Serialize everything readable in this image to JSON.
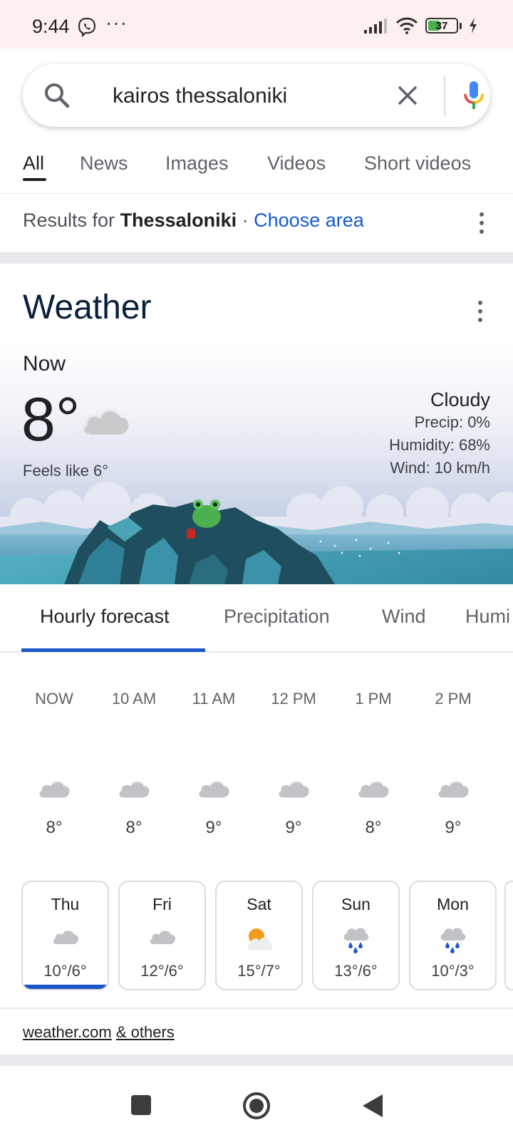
{
  "status": {
    "time": "9:44",
    "dots": "···",
    "battery": "37"
  },
  "search": {
    "query": "kairos thessaloniki"
  },
  "tabs": [
    "All",
    "News",
    "Images",
    "Videos",
    "Short videos"
  ],
  "results": {
    "prefix": "Results for",
    "place": "Thessaloniki",
    "separator": "·",
    "choose": "Choose area"
  },
  "weather": {
    "title": "Weather",
    "now_label": "Now",
    "temp": "8°",
    "feels": "Feels like 6°",
    "condition": "Cloudy",
    "precip": "Precip: 0%",
    "humidity": "Humidity: 68%",
    "wind": "Wind: 10 km/h"
  },
  "forecast_tabs": [
    "Hourly forecast",
    "Precipitation",
    "Wind",
    "Humi"
  ],
  "hourly": [
    {
      "time": "NOW",
      "temp": "8°",
      "icon": "cloud-icon"
    },
    {
      "time": "10 AM",
      "temp": "8°",
      "icon": "cloud-icon"
    },
    {
      "time": "11 AM",
      "temp": "9°",
      "icon": "cloud-icon"
    },
    {
      "time": "12 PM",
      "temp": "9°",
      "icon": "cloud-icon"
    },
    {
      "time": "1 PM",
      "temp": "8°",
      "icon": "cloud-icon"
    },
    {
      "time": "2 PM",
      "temp": "9°",
      "icon": "cloud-icon"
    }
  ],
  "daily": [
    {
      "day": "Thu",
      "range": "10°/6°",
      "icon": "cloud-icon"
    },
    {
      "day": "Fri",
      "range": "12°/6°",
      "icon": "cloud-icon"
    },
    {
      "day": "Sat",
      "range": "15°/7°",
      "icon": "partly-sunny-icon"
    },
    {
      "day": "Sun",
      "range": "13°/6°",
      "icon": "rain-icon"
    },
    {
      "day": "Mon",
      "range": "10°/3°",
      "icon": "rain-icon"
    }
  ],
  "sources": {
    "main": "weather.com",
    "others": "& others"
  },
  "colors": {
    "accent": "#1a56c8",
    "link": "#1558d6",
    "status_bar": "#fdf1ef"
  }
}
